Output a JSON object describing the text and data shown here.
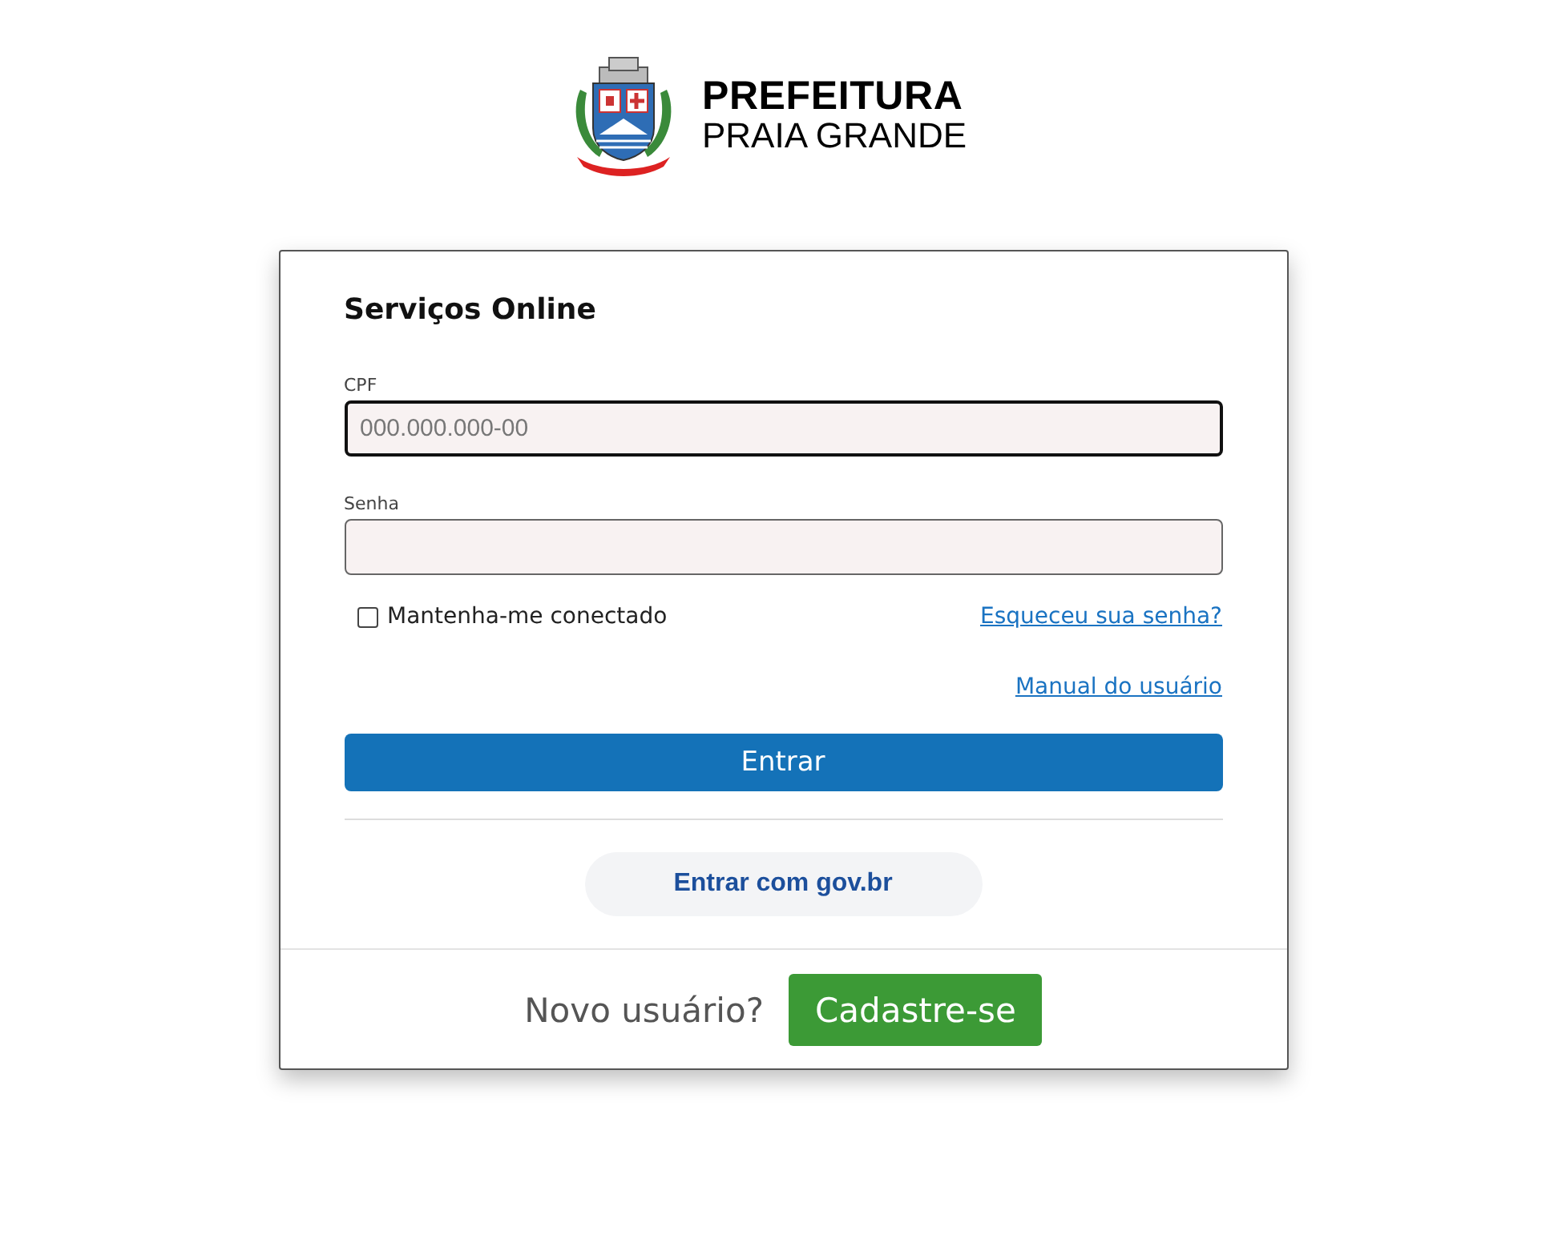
{
  "logo": {
    "line_1": "PREFEITURA",
    "line_2": "PRAIA GRANDE"
  },
  "form": {
    "title": "Serviços Online",
    "fields": [
      {
        "label": "CPF",
        "placeholder": "000.000.000-00",
        "focused": true
      },
      {
        "label": "Senha",
        "focused": false
      }
    ],
    "remember": {
      "label": "Mantenha-me conectado",
      "checked": false
    },
    "forgot_link": "Esqueceu sua senha?",
    "manual_link": "Manual do usuário",
    "submit": "Entrar",
    "govbr_button": "Entrar com gov.br"
  },
  "footer": {
    "prompt": "Novo usuário?",
    "button": "Cadastre-se"
  }
}
